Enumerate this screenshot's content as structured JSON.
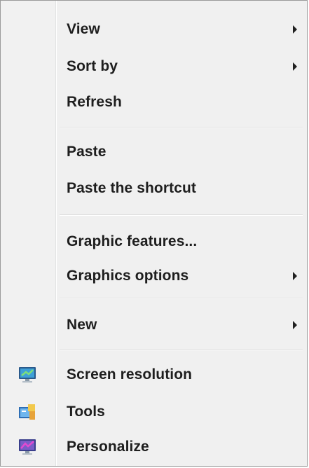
{
  "context_menu": {
    "items": [
      {
        "label": "View",
        "has_submenu": true
      },
      {
        "label": "Sort by",
        "has_submenu": true
      },
      {
        "label": "Refresh",
        "has_submenu": false
      },
      {
        "label": "Paste",
        "has_submenu": false
      },
      {
        "label": "Paste the shortcut",
        "has_submenu": false
      },
      {
        "label": "Graphic features...",
        "has_submenu": false
      },
      {
        "label": "Graphics options",
        "has_submenu": true
      },
      {
        "label": "New",
        "has_submenu": true
      },
      {
        "label": "Screen resolution",
        "has_submenu": false,
        "icon": "screen-resolution-icon"
      },
      {
        "label": "Tools",
        "has_submenu": false,
        "icon": "tools-icon"
      },
      {
        "label": "Personalize",
        "has_submenu": false,
        "icon": "personalize-icon"
      }
    ]
  },
  "colors": {
    "menu_background": "#f0f0f0",
    "text": "#1e1e1e",
    "border": "#9a9a9a"
  }
}
